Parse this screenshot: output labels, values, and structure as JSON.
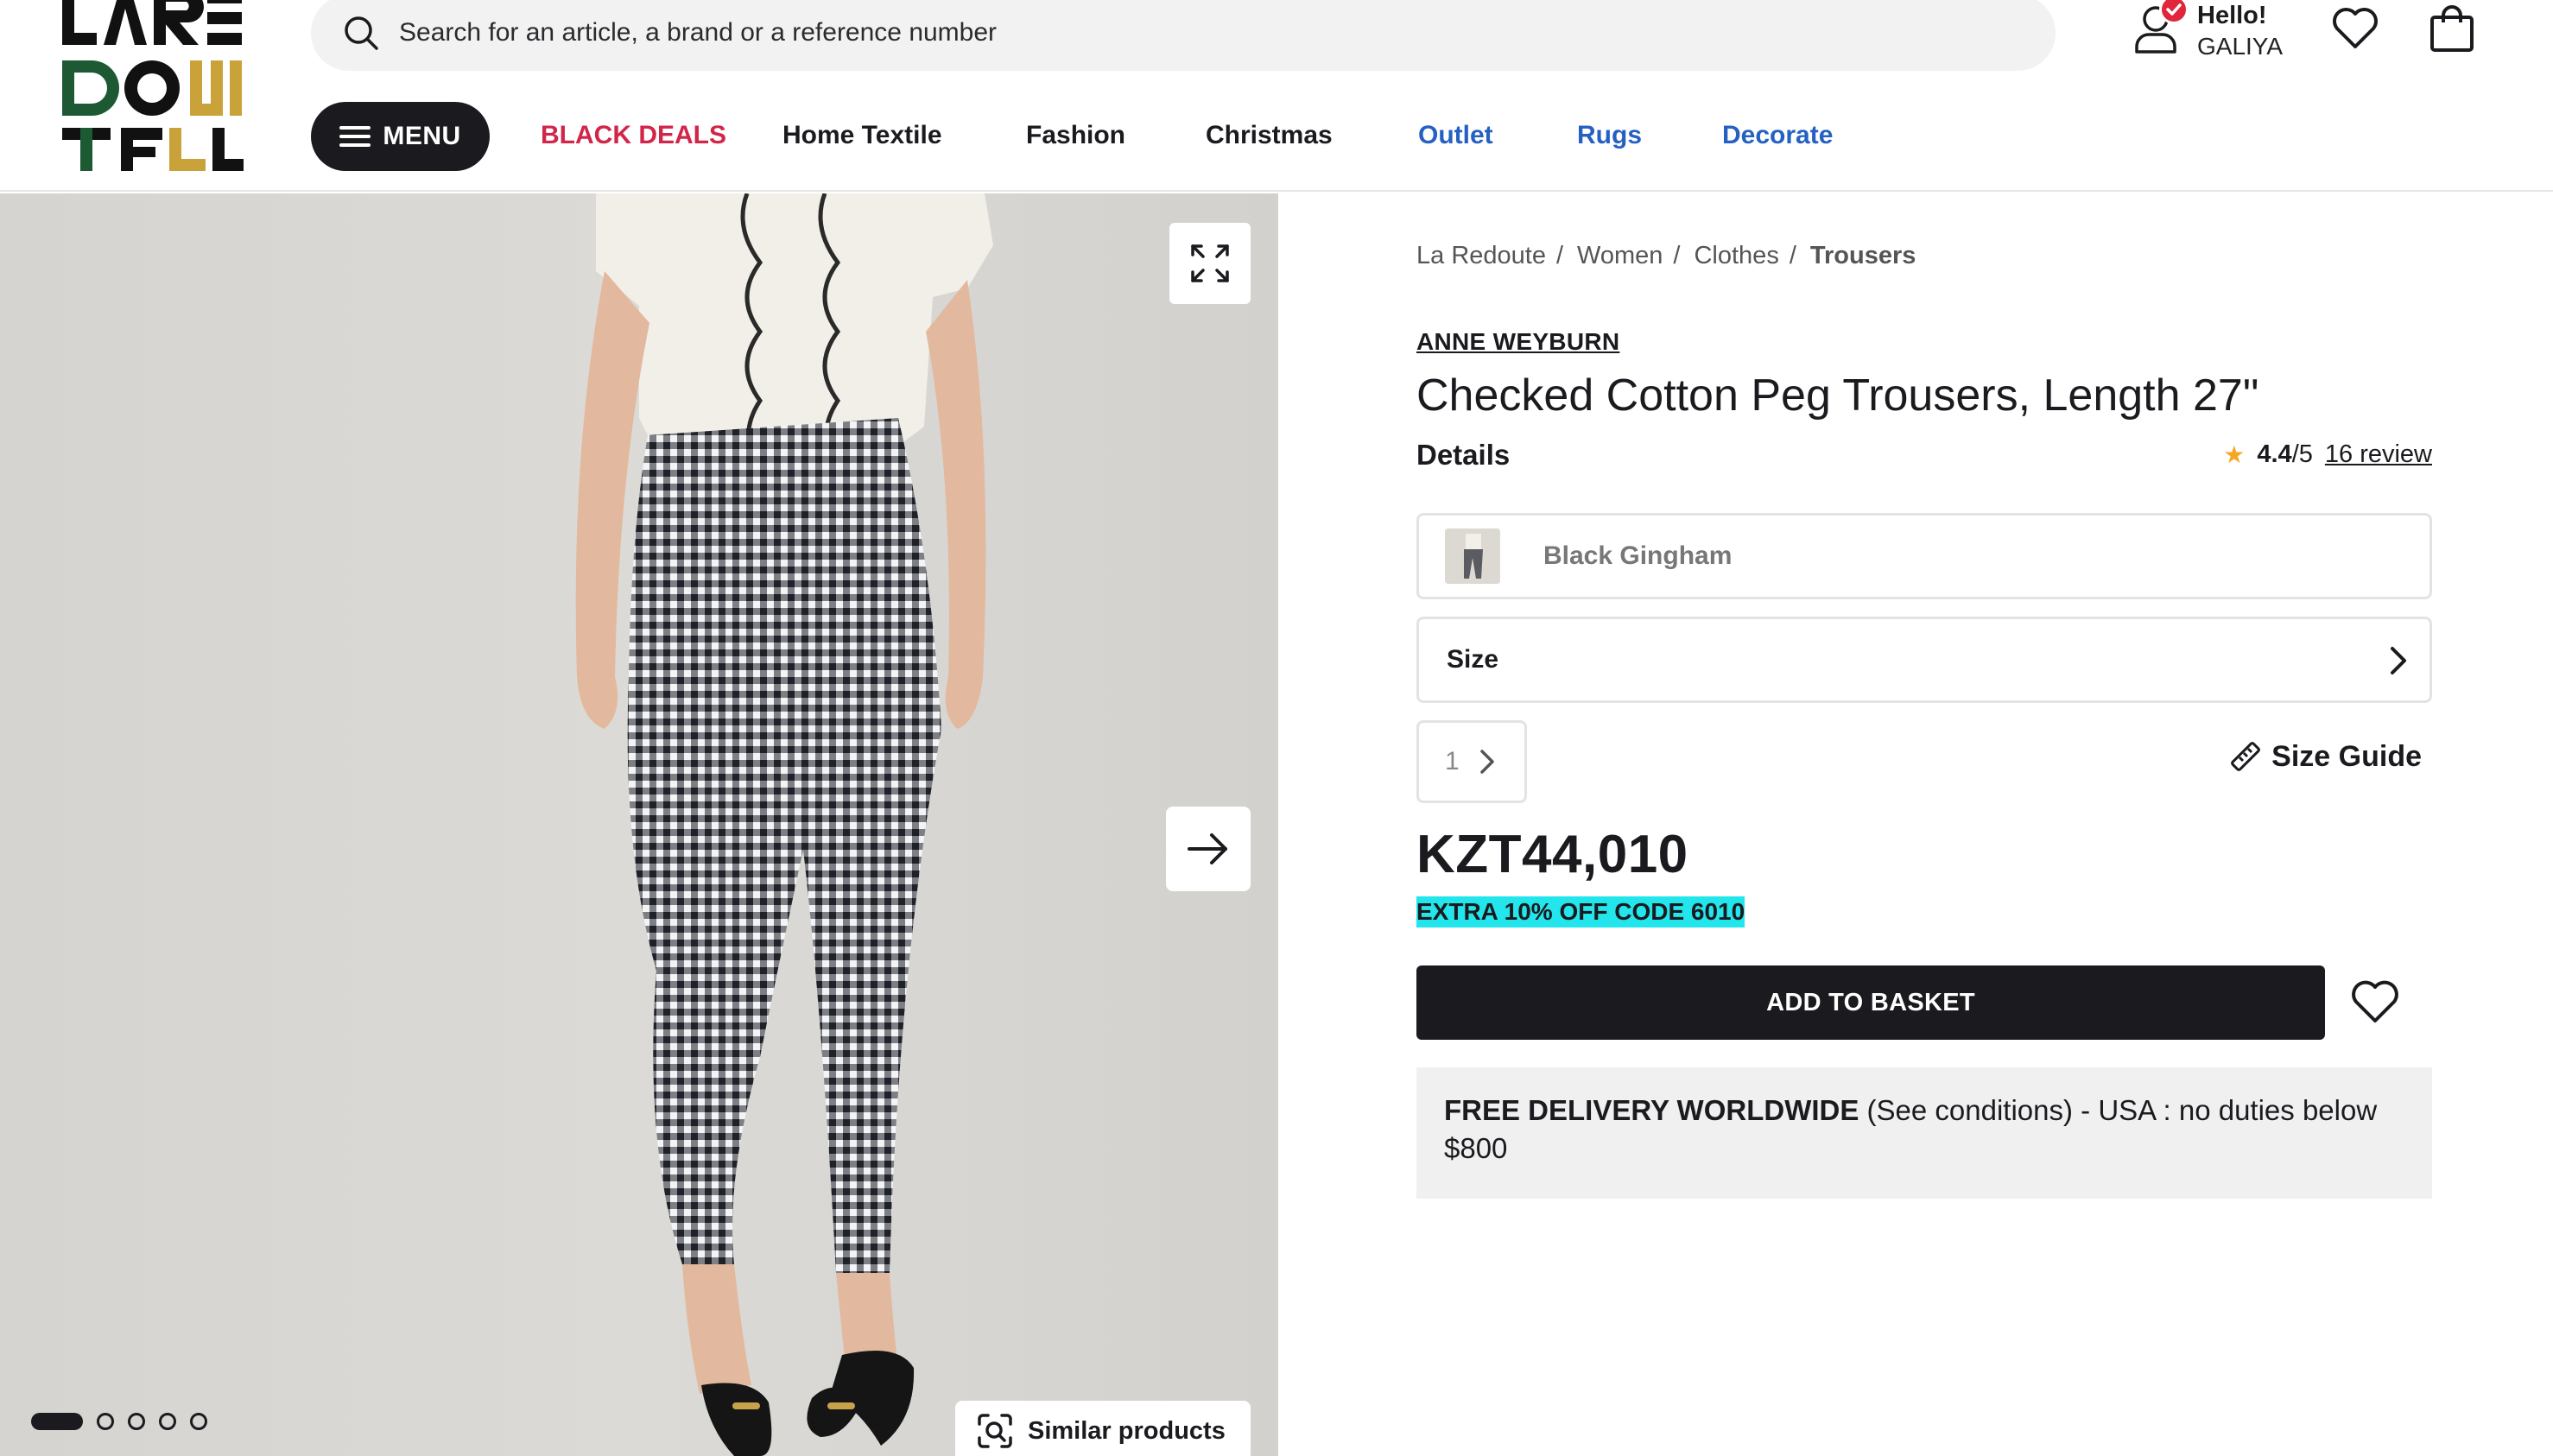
{
  "header": {
    "search_placeholder": "Search for an article, a brand or a reference number",
    "account": {
      "greeting": "Hello!",
      "name": "GALIYA"
    },
    "menu_label": "MENU",
    "nav": [
      {
        "label": "BLACK DEALS",
        "color": "#d2254a"
      },
      {
        "label": "Home Textile",
        "color": "#1b1b1f"
      },
      {
        "label": "Fashion",
        "color": "#1b1b1f"
      },
      {
        "label": "Christmas",
        "color": "#1b1b1f"
      },
      {
        "label": "Outlet",
        "color": "#2561c2"
      },
      {
        "label": "Rugs",
        "color": "#2561c2"
      },
      {
        "label": "Decorate",
        "color": "#2561c2"
      }
    ]
  },
  "gallery": {
    "similar_label": "Similar products",
    "slide_count": 5,
    "active_slide": 1
  },
  "product": {
    "breadcrumbs": [
      "La Redoute",
      "Women",
      "Clothes",
      "Trousers"
    ],
    "brand": "ANNE WEYBURN",
    "title": "Checked Cotton Peg Trousers, Length 27\"",
    "details_label": "Details",
    "rating": {
      "score": "4.4",
      "out_of": "/5",
      "reviews": "16 review"
    },
    "color_value": "Black Gingham",
    "size_label": "Size",
    "quantity": "1",
    "size_guide": "Size Guide",
    "price": "KZT44,010",
    "promo": "EXTRA 10% OFF CODE 6010",
    "add_to_basket": "ADD TO BASKET",
    "delivery_bold": "FREE DELIVERY WORLDWIDE",
    "delivery_rest": " (See conditions) - USA : no duties below $800"
  },
  "colors": {
    "accent_dark": "#1b1b1f",
    "promo_bg": "#22e6ec",
    "deal_red": "#d2254a",
    "nav_blue": "#2561c2"
  },
  "icons": [
    "search-icon",
    "user-icon",
    "check-badge-icon",
    "heart-icon",
    "shopping-bag-icon",
    "hamburger-icon",
    "expand-icon",
    "arrow-right-icon",
    "visual-search-icon",
    "star-icon",
    "chevron-right-icon",
    "ruler-icon"
  ]
}
